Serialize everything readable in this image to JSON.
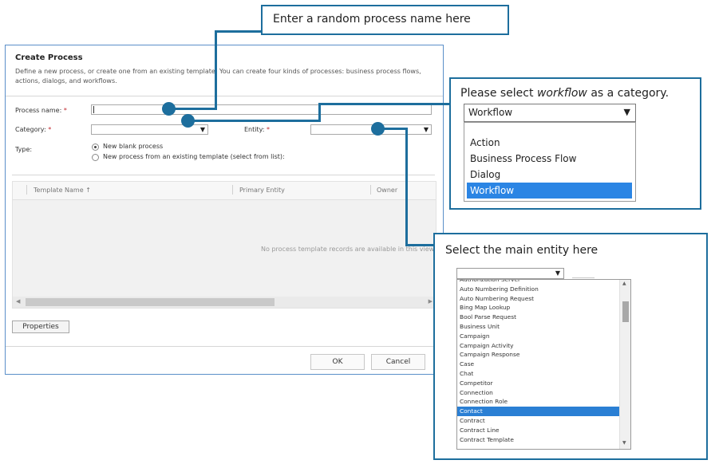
{
  "dialog": {
    "title": "Create Process",
    "description": "Define a new process, or create one from an existing template. You can create four kinds of processes: business process flows, actions, dialogs, and workflows.",
    "process_name_label": "Process name:",
    "category_label": "Category:",
    "entity_label": "Entity:",
    "required_mark": "*",
    "type_label": "Type:",
    "type_options": [
      "New blank process",
      "New process from an existing template (select from list):"
    ],
    "selected_type": "New blank process",
    "grid": {
      "columns": [
        "Template Name",
        "Primary Entity",
        "Owner"
      ],
      "sort_arrow": "↑",
      "empty_message": "No process template records are available in this view."
    },
    "properties_label": "Properties",
    "ok_label": "OK",
    "cancel_label": "Cancel",
    "dropdown_caret": "▼"
  },
  "callouts": {
    "name_hint": "Enter a random process name here",
    "category_hint_prefix": "Please select ",
    "category_hint_emph": "workflow",
    "category_hint_suffix": " as a category.",
    "entity_hint": "Select the main entity here"
  },
  "category_dropdown": {
    "selected": "Workflow",
    "options": [
      "Action",
      "Business Process Flow",
      "Dialog",
      "Workflow"
    ]
  },
  "entity_dropdown": {
    "selected": "Contact",
    "options": [
      "Authorization Server",
      "Auto Numbering Definition",
      "Auto Numbering Request",
      "Bing Map Lookup",
      "Bool Parse Request",
      "Business Unit",
      "Campaign",
      "Campaign Activity",
      "Campaign Response",
      "Case",
      "Chat",
      "Competitor",
      "Connection",
      "Connection Role",
      "Contact",
      "Contract",
      "Contract Line",
      "Contract Template"
    ]
  },
  "colors": {
    "callout_accent": "#1d6e9d",
    "selection_blue": "#2b85e4",
    "required_red": "#c0272d",
    "dialog_border": "#5b8fc9"
  }
}
